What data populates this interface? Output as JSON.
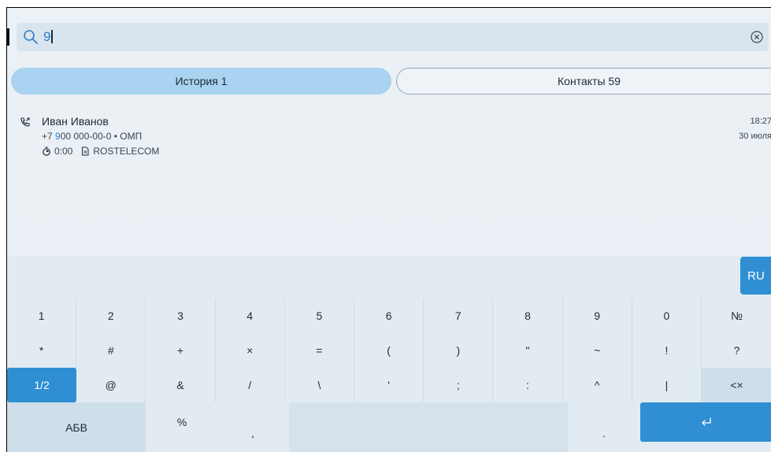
{
  "search": {
    "query": "9"
  },
  "tabs": {
    "history": "История 1",
    "contacts": "Контакты 59"
  },
  "call": {
    "name": "Иван Иванов",
    "number_prefix": "+7 ",
    "number_match": "9",
    "number_rest": "00 000-00-0 • ОМП",
    "duration": "0:00",
    "operator": "ROSTELECOM",
    "time": "18:27",
    "date": "30 июля"
  },
  "keyboard": {
    "lang": "RU",
    "row1": [
      "1",
      "2",
      "3",
      "4",
      "5",
      "6",
      "7",
      "8",
      "9",
      "0",
      "№"
    ],
    "row2": [
      "*",
      "#",
      "+",
      "×",
      "=",
      "(",
      ")",
      "\"",
      "~",
      "!",
      "?"
    ],
    "row3": [
      "1/2",
      "@",
      "&",
      "/",
      "\\",
      "'",
      ";",
      ":",
      "^",
      "|",
      "<×"
    ],
    "row4": {
      "abc": "АБВ",
      "percent": "%",
      "comma": ",",
      "dot": ".",
      "enter": "↵"
    }
  },
  "icons": [
    "search-icon",
    "clear-icon",
    "outgoing-call-icon",
    "timer-icon",
    "document-icon",
    "backspace-icon",
    "enter-icon"
  ]
}
